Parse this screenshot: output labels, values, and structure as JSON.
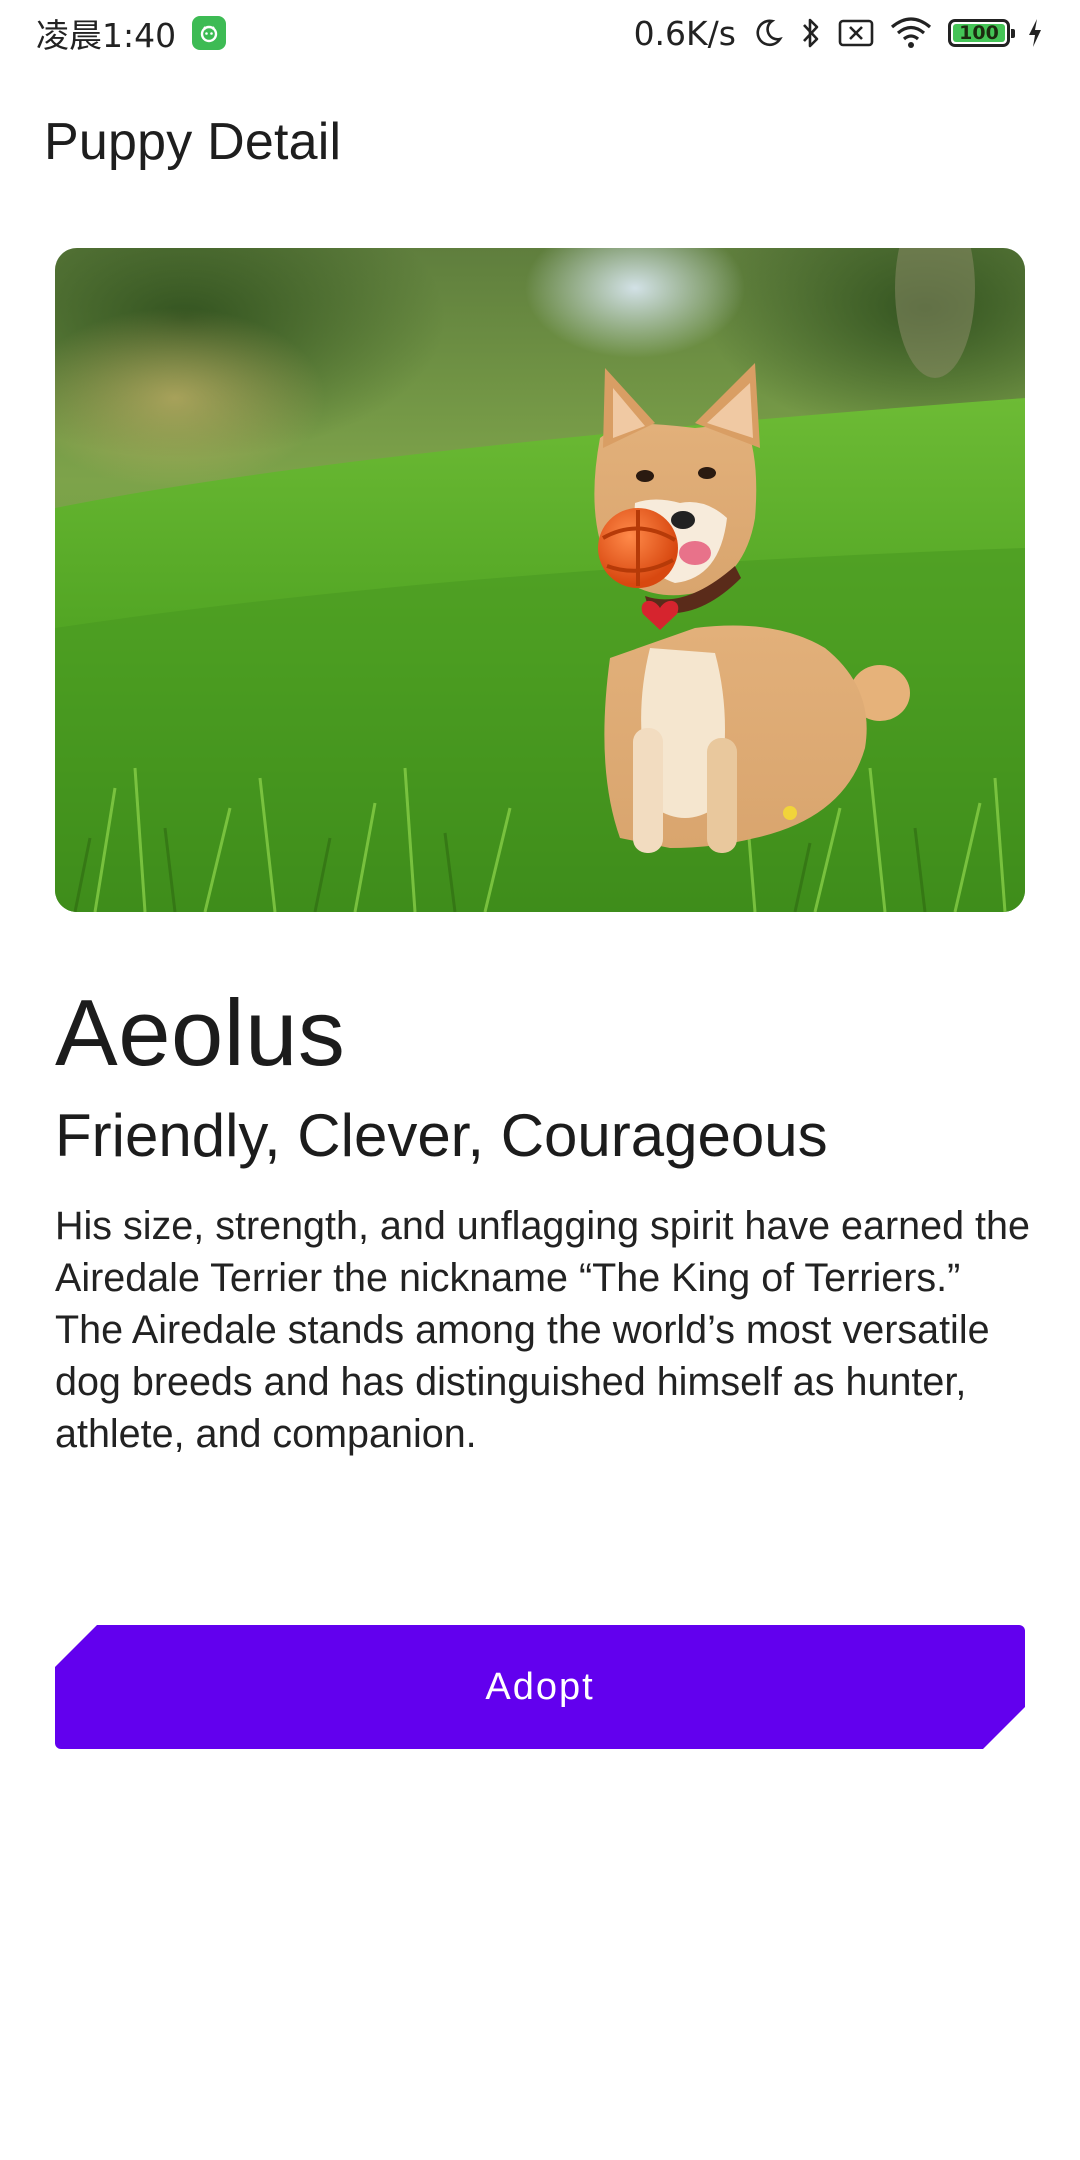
{
  "status_bar": {
    "time": "凌晨1:40",
    "network_speed": "0.6K/s",
    "battery_level": "100",
    "battery_fraction": 1.0,
    "icons": [
      "app-notification-icon",
      "moon-icon",
      "bluetooth-icon",
      "sim-x-icon",
      "wifi-icon",
      "battery-icon",
      "charging-icon"
    ]
  },
  "app_bar": {
    "title": "Puppy Detail"
  },
  "puppy": {
    "image_alt": "Shiba Inu puppy sitting in grass holding an orange ball",
    "name": "Aeolus",
    "traits": "Friendly, Clever, Courageous",
    "description": "His size, strength, and unflagging spirit have earned the Airedale Terrier the nickname “The King of Terriers.” The Airedale stands among the world’s most versatile dog breeds and has distinguished himself as hunter, athlete, and companion."
  },
  "actions": {
    "adopt_label": "Adopt"
  },
  "colors": {
    "accent": "#6200ee",
    "text": "#1c1c1c",
    "background": "#ffffff"
  }
}
